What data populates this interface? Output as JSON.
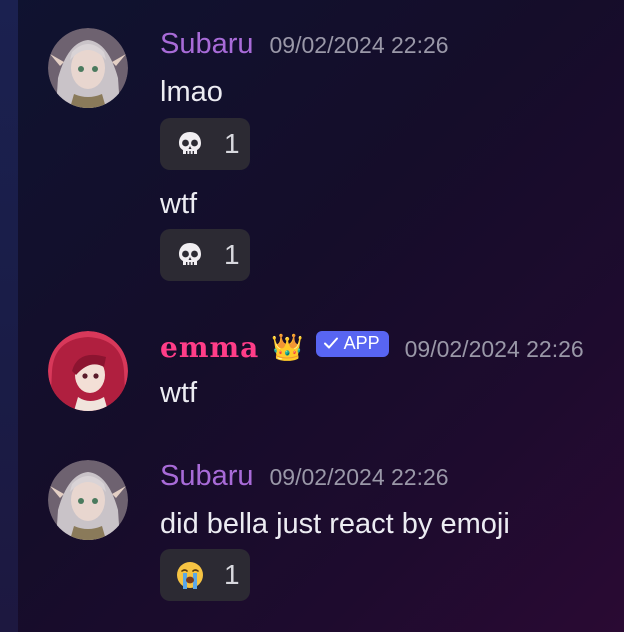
{
  "messages": [
    {
      "username": "Subaru",
      "timestamp": "09/02/2024 22:26",
      "lines": [
        {
          "text": "lmao",
          "reaction": {
            "emoji": "skull-emoji",
            "count": "1"
          }
        },
        {
          "text": "wtf",
          "reaction": {
            "emoji": "skull-emoji",
            "count": "1"
          }
        }
      ]
    },
    {
      "username": "emma",
      "badge_emoji": "👑",
      "app_badge": "APP",
      "timestamp": "09/02/2024 22:26",
      "lines": [
        {
          "text": "wtf"
        }
      ]
    },
    {
      "username": "Subaru",
      "timestamp": "09/02/2024 22:26",
      "lines": [
        {
          "text": "did bella just react by emoji",
          "reaction": {
            "emoji": "loudly-crying-face-emoji",
            "count": "1"
          }
        }
      ]
    }
  ],
  "colors": {
    "subaru_name": "#a86bd8",
    "emma_name": "#ff3d88",
    "app_badge_bg": "#5865f2",
    "reaction_bg": "#2c2a33"
  }
}
